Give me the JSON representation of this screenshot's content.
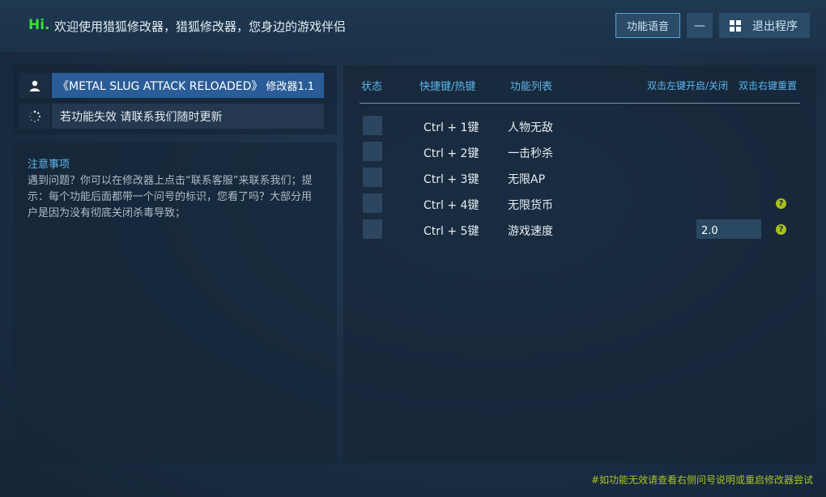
{
  "header": {
    "hi": "Hi.",
    "welcome": "欢迎使用猎狐修改器，猎狐修改器，您身边的游戏伴侣",
    "voice_button": "功能语音",
    "minimize_button": "—",
    "exit_button": "退出程序"
  },
  "game": {
    "title": "《METAL SLUG ATTACK RELOADED》",
    "version": "修改器1.1",
    "icon": "user-icon"
  },
  "update": {
    "text": "若功能失效  请联系我们随时更新",
    "icon": "loading-icon"
  },
  "notes": {
    "title": "注意事项",
    "body": "遇到问题？你可以在修改器上点击“联系客服”来联系我们；提示：每个功能后面都带一个问号的标识，您看了吗？大部分用户是因为没有彻底关闭杀毒导致；"
  },
  "table": {
    "headers": {
      "status": "状态",
      "hotkey": "快捷键/热键",
      "functions": "功能列表",
      "left_toggle": "双击左键开启/关闭",
      "right_reset": "双击右键重置"
    },
    "rows": [
      {
        "key": "Ctrl  +  1键",
        "name": "人物无敌"
      },
      {
        "key": "Ctrl  +  2键",
        "name": "一击秒杀"
      },
      {
        "key": "Ctrl  +  3键",
        "name": "无限AP"
      },
      {
        "key": "Ctrl  +  4键",
        "name": "无限货币",
        "help": "?"
      },
      {
        "key": "Ctrl  +  5键",
        "name": "游戏速度",
        "value": "2.0",
        "help": "?"
      }
    ]
  },
  "footer": {
    "note": "#如功能无效请查看右侧问号说明或重启修改器尝试"
  },
  "colors": {
    "accent_blue": "#5fb6ea",
    "hi_green": "#35e035",
    "help_green": "#a8c01e",
    "selected_game": "#2a5d97"
  }
}
